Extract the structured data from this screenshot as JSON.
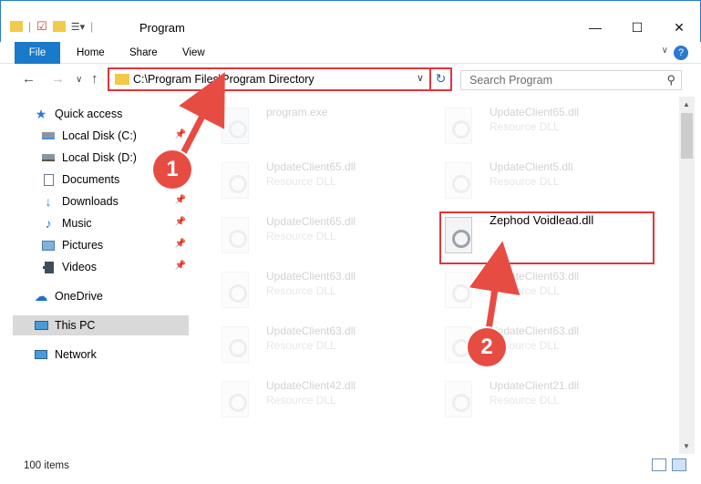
{
  "window": {
    "title": "Program",
    "minimize_symbol": "—",
    "maximize_symbol": "☐",
    "close_symbol": "✕"
  },
  "ribbon": {
    "tabs": [
      "File",
      "Home",
      "Share",
      "View"
    ]
  },
  "address": {
    "path": "C:\\Program Files\\Program Directory"
  },
  "search": {
    "placeholder": "Search Program"
  },
  "sidebar": {
    "items": [
      {
        "label": "Quick access",
        "icon": "star-icon",
        "pinned": false
      },
      {
        "label": "Local Disk (C:)",
        "icon": "drive-icon",
        "pinned": true
      },
      {
        "label": "Local Disk (D:)",
        "icon": "drive-icon",
        "pinned": false
      },
      {
        "label": "Documents",
        "icon": "documents-icon",
        "pinned": true
      },
      {
        "label": "Downloads",
        "icon": "downloads-icon",
        "pinned": true
      },
      {
        "label": "Music",
        "icon": "music-icon",
        "pinned": true
      },
      {
        "label": "Pictures",
        "icon": "pictures-icon",
        "pinned": true
      },
      {
        "label": "Videos",
        "icon": "videos-icon",
        "pinned": true
      },
      {
        "label": "OneDrive",
        "icon": "cloud-icon",
        "pinned": false
      },
      {
        "label": "This PC",
        "icon": "computer-icon",
        "pinned": false,
        "selected": true
      },
      {
        "label": "Network",
        "icon": "network-icon",
        "pinned": false
      }
    ]
  },
  "files": [
    {
      "name": "program.exe",
      "desc": "",
      "faded": true
    },
    {
      "name": "UpdateClient65.dll",
      "desc": "Resource DLL",
      "faded": true
    },
    {
      "name": "UpdateClient65.dll",
      "desc": "Resource DLL",
      "faded": true
    },
    {
      "name": "UpdateClient5.dll",
      "desc": "Resource DLL",
      "faded": true
    },
    {
      "name": "UpdateClient65.dll",
      "desc": "Resource DLL",
      "faded": true
    },
    {
      "name": "Zephod Voidlead.dll",
      "desc": "",
      "faded": false
    },
    {
      "name": "UpdateClient63.dll",
      "desc": "Resource DLL",
      "faded": true
    },
    {
      "name": "UpdateClient63.dll",
      "desc": "Resource DLL",
      "faded": true
    },
    {
      "name": "UpdateClient63.dll",
      "desc": "Resource DLL",
      "faded": true
    },
    {
      "name": "UpdateClient63.dll",
      "desc": "Resource DLL",
      "faded": true
    },
    {
      "name": "UpdateClient42.dll",
      "desc": "Resource DLL",
      "faded": true
    },
    {
      "name": "UpdateClient21.dll",
      "desc": "Resource DLL",
      "faded": true
    }
  ],
  "status": {
    "item_count": "100 items"
  },
  "annotations": {
    "step1": "1",
    "step2": "2",
    "color": "#e74c43"
  }
}
